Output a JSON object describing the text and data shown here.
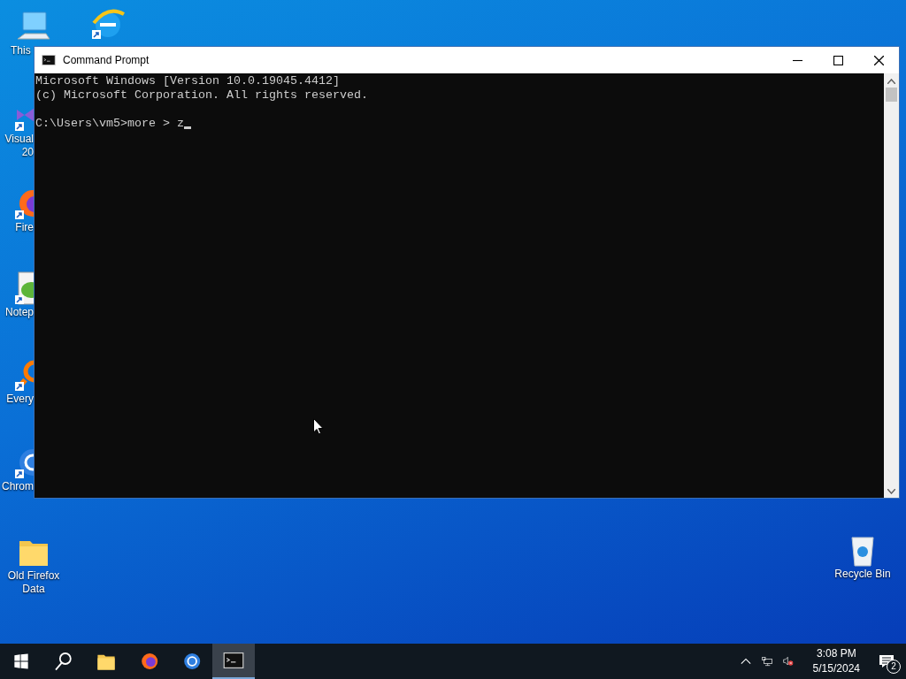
{
  "desktop_icons": [
    {
      "kind": "computer",
      "lines": [
        "This"
      ]
    },
    {
      "kind": "browser-e"
    },
    {
      "kind": "studio",
      "lines": [
        "Visual",
        "20"
      ]
    },
    {
      "kind": "fox",
      "lines": [
        "Fire"
      ]
    },
    {
      "kind": "notepad",
      "lines": [
        "Notep"
      ]
    },
    {
      "kind": "magnifier",
      "lines": [
        "Every"
      ]
    },
    {
      "kind": "ring",
      "lines": [
        "Chrom"
      ]
    },
    {
      "kind": "folder",
      "lines": [
        "Old Firefox",
        "Data"
      ]
    },
    {
      "kind": "bin",
      "lines": [
        "Recycle Bin"
      ]
    }
  ],
  "window": {
    "title": "Command Prompt",
    "output": [
      "Microsoft Windows [Version 10.0.19045.4412]",
      "(c) Microsoft Corporation. All rights reserved."
    ],
    "prompt": "C:\\Users\\vm5>more > z",
    "cursor": true
  },
  "taskbar": {
    "apps": [
      {
        "kind": "start",
        "selected": false
      },
      {
        "kind": "search",
        "selected": false
      },
      {
        "kind": "folder",
        "selected": false
      },
      {
        "kind": "fox",
        "selected": false
      },
      {
        "kind": "ring",
        "selected": false
      },
      {
        "kind": "console",
        "selected": true
      }
    ],
    "time": "3:08 PM",
    "date": "5/15/2024",
    "notifications": "2"
  }
}
